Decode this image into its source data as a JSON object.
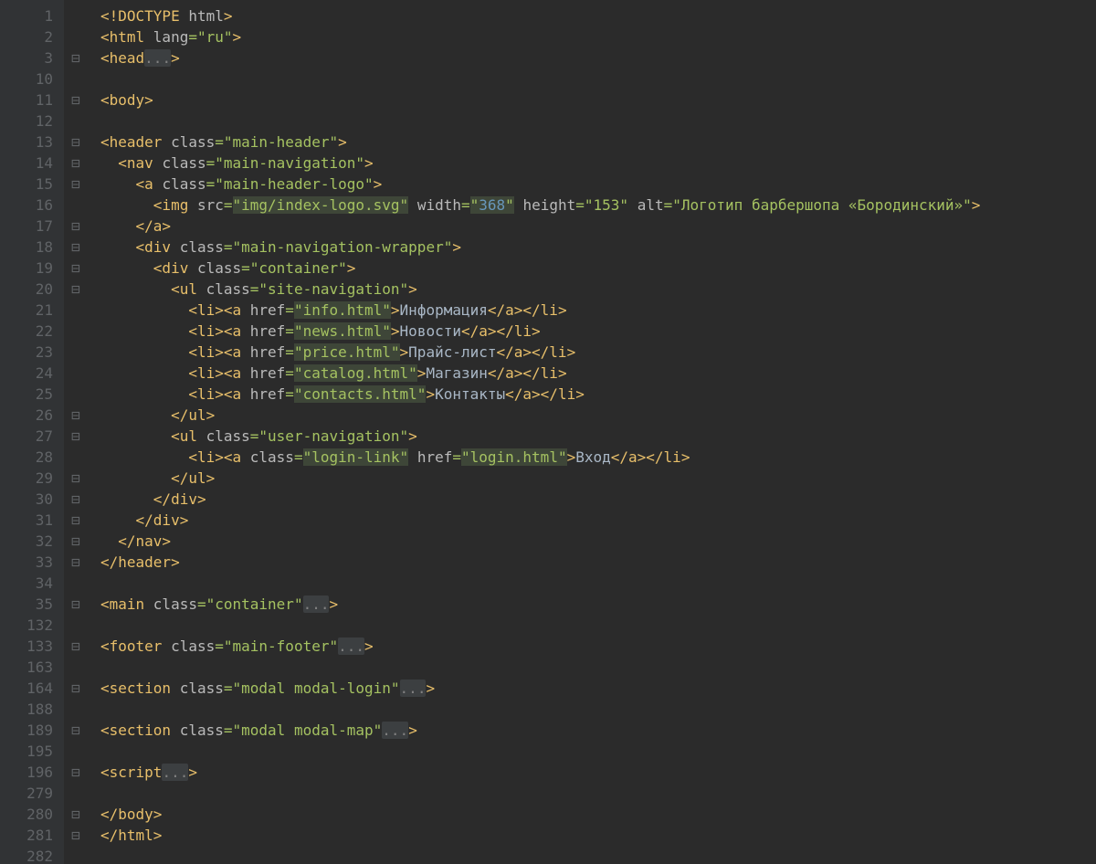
{
  "gutter": [
    "1",
    "2",
    "3",
    "10",
    "11",
    "12",
    "13",
    "14",
    "15",
    "16",
    "17",
    "18",
    "19",
    "20",
    "21",
    "22",
    "23",
    "24",
    "25",
    "26",
    "27",
    "28",
    "29",
    "30",
    "31",
    "32",
    "33",
    "34",
    "35",
    "132",
    "133",
    "163",
    "164",
    "188",
    "189",
    "195",
    "196",
    "279",
    "280",
    "281",
    "282"
  ],
  "fold": [
    "",
    "",
    "-",
    "",
    "-",
    "",
    "-",
    "-",
    "-",
    "",
    "-",
    "-",
    "-",
    "-",
    "",
    "",
    "",
    "",
    "",
    "-",
    "-",
    "",
    "-",
    "-",
    "-",
    "-",
    "-",
    "",
    "-",
    "",
    "-",
    "",
    "-",
    "",
    "-",
    "",
    "-",
    "",
    "-",
    "-",
    ""
  ],
  "code": {
    "l1": {
      "t1": "<!DOCTYPE ",
      "a1": "html",
      "t2": ">"
    },
    "l2": {
      "t1": "<html ",
      "a1": "lang",
      "eq": "=",
      "v1": "\"ru\"",
      "t2": ">"
    },
    "l3": {
      "t1": "<head",
      "el": "...",
      "t2": ">"
    },
    "l4": "",
    "l5": {
      "t1": "<body>"
    },
    "l6": "",
    "l7": {
      "t1": "<header ",
      "a1": "class",
      "eq": "=",
      "v1": "\"main-header\"",
      "t2": ">"
    },
    "l8": {
      "t1": "<nav ",
      "a1": "class",
      "eq": "=",
      "v1": "\"main-navigation\"",
      "t2": ">"
    },
    "l9": {
      "t1": "<a ",
      "a1": "class",
      "eq": "=",
      "v1": "\"main-header-logo\"",
      "t2": ">"
    },
    "l10": {
      "t1": "<img ",
      "a1": "src",
      "eq1": "=",
      "v1": "\"img/index-logo.svg\"",
      "a2": "width",
      "eq2": "=",
      "nq": "\"",
      "n": "368",
      "nq2": "\"",
      "a3": "height",
      "eq3": "=",
      "v3": "\"153\"",
      "a4": "alt",
      "eq4": "=",
      "v4": "\"Логотип барбершопа «Бородинский»\"",
      "t2": ">"
    },
    "l11": {
      "t1": "</a>"
    },
    "l12": {
      "t1": "<div ",
      "a1": "class",
      "eq": "=",
      "v1": "\"main-navigation-wrapper\"",
      "t2": ">"
    },
    "l13": {
      "t1": "<div ",
      "a1": "class",
      "eq": "=",
      "v1": "\"container\"",
      "t2": ">"
    },
    "l14": {
      "t1": "<ul ",
      "a1": "class",
      "eq": "=",
      "v1": "\"site-navigation\"",
      "t2": ">"
    },
    "l15": {
      "t1": "<li><a ",
      "a1": "href",
      "eq": "=",
      "v1": "\"info.html\"",
      "t2": ">",
      "txt": "Информация",
      "t3": "</a></li>"
    },
    "l16": {
      "t1": "<li><a ",
      "a1": "href",
      "eq": "=",
      "v1": "\"news.html\"",
      "t2": ">",
      "txt": "Новости",
      "t3": "</a></li>"
    },
    "l17": {
      "t1": "<li><a ",
      "a1": "href",
      "eq": "=",
      "v1": "\"price.html\"",
      "t2": ">",
      "txt": "Прайс-лист",
      "t3": "</a></li>"
    },
    "l18": {
      "t1": "<li><a ",
      "a1": "href",
      "eq": "=",
      "v1": "\"catalog.html\"",
      "t2": ">",
      "txt": "Магазин",
      "t3": "</a></li>"
    },
    "l19": {
      "t1": "<li><a ",
      "a1": "href",
      "eq": "=",
      "v1": "\"contacts.html\"",
      "t2": ">",
      "txt": "Контакты",
      "t3": "</a></li>"
    },
    "l20": {
      "t1": "</ul>"
    },
    "l21": {
      "t1": "<ul ",
      "a1": "class",
      "eq": "=",
      "v1": "\"user-navigation\"",
      "t2": ">"
    },
    "l22": {
      "t1": "<li><a ",
      "a1": "class",
      "eq1": "=",
      "v1": "\"login-link\"",
      "a2": "href",
      "eq2": "=",
      "v2": "\"login.html\"",
      "t2": ">",
      "txt": "Вход",
      "t3": "</a></li>"
    },
    "l23": {
      "t1": "</ul>"
    },
    "l24": {
      "t1": "</div>"
    },
    "l25": {
      "t1": "</div>"
    },
    "l26": {
      "t1": "</nav>"
    },
    "l27": {
      "t1": "</header>"
    },
    "l28": "",
    "l29": {
      "t1": "<main ",
      "a1": "class",
      "eq": "=",
      "v1": "\"container\"",
      "el": "...",
      "t2": ">"
    },
    "l30": "",
    "l31": {
      "t1": "<footer ",
      "a1": "class",
      "eq": "=",
      "v1": "\"main-footer\"",
      "el": "...",
      "t2": ">"
    },
    "l32": "",
    "l33": {
      "t1": "<section ",
      "a1": "class",
      "eq": "=",
      "v1": "\"modal modal-login\"",
      "el": "...",
      "t2": ">"
    },
    "l34": "",
    "l35": {
      "t1": "<section ",
      "a1": "class",
      "eq": "=",
      "v1": "\"modal modal-map\"",
      "el": "...",
      "t2": ">"
    },
    "l36": "",
    "l37": {
      "t1": "<script",
      "el": "...",
      "t2": ">"
    },
    "l38": "",
    "l39": {
      "t1": "</body>"
    },
    "l40": {
      "t1": "</html>"
    },
    "l41": ""
  },
  "indent": {
    "l1": "",
    "l2": "",
    "l3": "",
    "l4": "",
    "l5": "",
    "l6": "",
    "l7": "",
    "l8": "  ",
    "l9": "    ",
    "l10": "      ",
    "l11": "    ",
    "l12": "    ",
    "l13": "      ",
    "l14": "        ",
    "l15": "          ",
    "l16": "          ",
    "l17": "          ",
    "l18": "          ",
    "l19": "          ",
    "l20": "        ",
    "l21": "        ",
    "l22": "          ",
    "l23": "        ",
    "l24": "      ",
    "l25": "    ",
    "l26": "  ",
    "l27": "",
    "l28": "",
    "l29": "",
    "l30": "",
    "l31": "",
    "l32": "",
    "l33": "",
    "l34": "",
    "l35": "",
    "l36": "",
    "l37": "",
    "l38": "",
    "l39": "",
    "l40": "",
    "l41": ""
  }
}
